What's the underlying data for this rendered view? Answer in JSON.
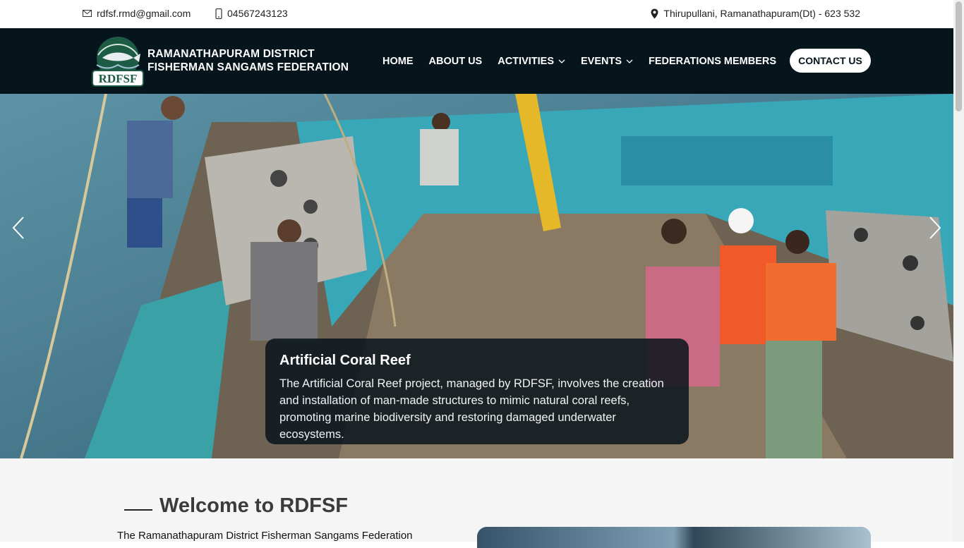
{
  "topbar": {
    "email": "rdfsf.rmd@gmail.com",
    "phone": "04567243123",
    "address": "Thirupullani, Ramanathapuram(Dt) - 623 532"
  },
  "header": {
    "logo_text": "RDFSF",
    "brand_line1": "RAMANATHAPURAM DISTRICT",
    "brand_line2": "FISHERMAN SANGAMS FEDERATION",
    "nav": [
      {
        "label": "HOME",
        "dropdown": false
      },
      {
        "label": "ABOUT US",
        "dropdown": false
      },
      {
        "label": "ACTIVITIES",
        "dropdown": true
      },
      {
        "label": "EVENTS",
        "dropdown": true
      },
      {
        "label": "FEDERATIONS MEMBERS",
        "dropdown": false
      }
    ],
    "contact_label": "CONTACT US"
  },
  "hero": {
    "caption_title": "Artificial Coral Reef",
    "caption_text": "The Artificial Coral Reef project, managed by RDFSF, involves the creation and installation of man-made structures to mimic natural coral reefs, promoting marine biodiversity and restoring damaged underwater ecosystems.",
    "prev_icon": "chevron-left-icon",
    "next_icon": "chevron-right-icon"
  },
  "welcome": {
    "title": "Welcome to RDFSF",
    "intro": "The Ramanathapuram District Fisherman Sangams Federation"
  },
  "colors": {
    "header_bg": "#06141b",
    "accent_green": "#1e5b45",
    "welcome_bg": "#f5f5f5"
  }
}
